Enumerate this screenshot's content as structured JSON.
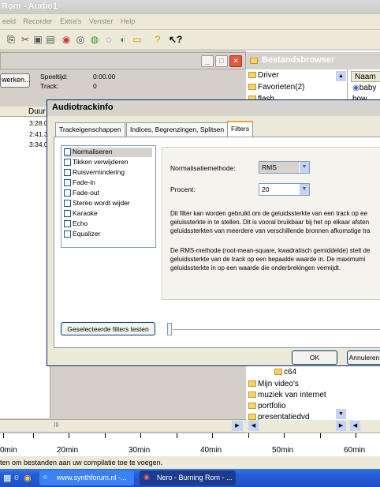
{
  "window": {
    "title": "Rom - Audio1"
  },
  "menu": [
    "eeld",
    "Recorder",
    "Extra's",
    "Venster",
    "Help"
  ],
  "session": {
    "button_label": "werken...",
    "playtime_label": "Speeltijd:",
    "playtime_value": "0:00.00",
    "track_label": "Track:",
    "track_value": "0"
  },
  "tracklist": {
    "header": "Duur",
    "durations": [
      "3:28.0",
      "2:41.3",
      "3:34.0"
    ]
  },
  "browser": {
    "title": "Bestandsbrowser",
    "column_header": "Naam",
    "tree_top": [
      "Driver",
      "Favorieten(2)",
      "flash"
    ],
    "tree_bottom": [
      "c64",
      "Mijn video's",
      "muziek van internet",
      "portfolio",
      "presentatiedvd"
    ],
    "files": [
      "baby",
      "bow"
    ]
  },
  "dialog": {
    "title": "Audiotrackinfo",
    "tabs": [
      "Trackeigenschappen",
      "Indices, Begrenzingen, Splitsen",
      "Filters"
    ],
    "filters": [
      "Normaliseren",
      "Tikken verwijderen",
      "Ruisvermindering",
      "Fade-in",
      "Fade-out",
      "Stereo wordt wijder",
      "Karaoke",
      "Echo",
      "Equalizer"
    ],
    "method_label": "Normalisatiemethode:",
    "method_value": "RMS",
    "percent_label": "Procent:",
    "percent_value": "20",
    "desc1": [
      "Dit filter kan worden gebruikt om de geluidssterkte van een track op ee",
      "geluissterkte in te stellen. Dit is vooral bruikbaar bij het op elkaar afsten",
      "geluidssterkten van meerdere van verschillende bronnen afkomstige tra"
    ],
    "desc2": [
      "De RMS-methode (root-mean-square, kwadratisch gemiddelde) stelt de",
      "geluidssterkte van de track op een bepaalde waarde in. De maximumi",
      "geluidssterkte in op een waarde die onderbrekingen vermijdt."
    ],
    "test_button": "Geselecteerde filters testen",
    "ok_button": "OK",
    "cancel_button": "Annuleren"
  },
  "ruler": {
    "labels": [
      "0min",
      "20min",
      "30min",
      "40min",
      "50min",
      "60min"
    ]
  },
  "scroll_label": "III",
  "status": {
    "text": "ten om bestanden aan uw compilatie toe te voegen."
  },
  "taskbar": {
    "items": [
      "www.synthforum.nl -...",
      "Nero - Burning Rom - ..."
    ]
  }
}
